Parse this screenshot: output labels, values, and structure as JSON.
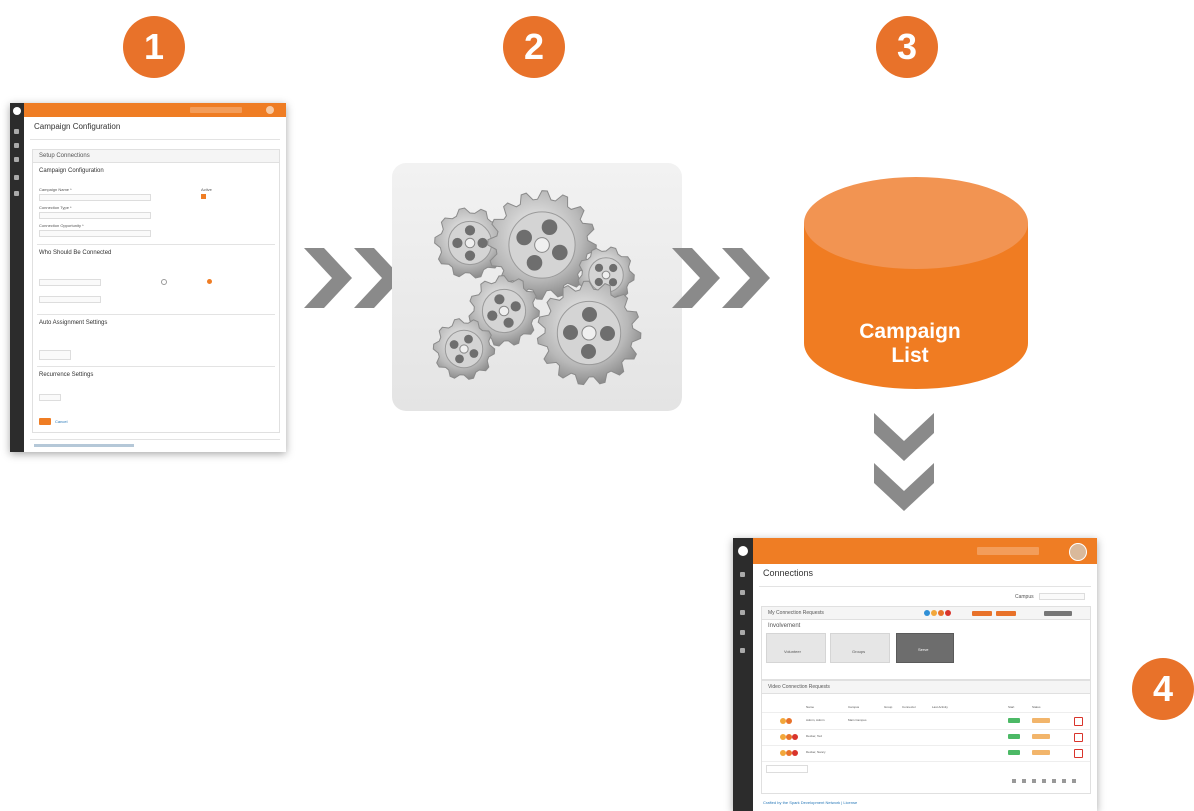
{
  "steps": [
    "1",
    "2",
    "3",
    "4"
  ],
  "colors": {
    "accent": "#e8722a",
    "cylinder": "#f07c22",
    "chevron": "#8a8a8a",
    "sidebar": "#2c2c2c"
  },
  "screenshot1": {
    "page_title": "Campaign Configuration",
    "panel_header": "Setup Connections",
    "section_title": "Campaign Configuration",
    "fields": [
      "Campaign Name *",
      "Connection Type *",
      "Connection Opportunity *"
    ],
    "active_label": "Active",
    "who_title": "Who Should Be Connected",
    "auto_title": "Auto Assignment Settings",
    "recurrence_title": "Recurrence Settings",
    "save_label": "Save",
    "cancel_label": "Cancel"
  },
  "cylinder_label": [
    "Campaign",
    "List"
  ],
  "screenshot4": {
    "page_title": "Connections",
    "campus_label": "Campus",
    "panel1_title": "My Connection Requests",
    "group_title": "Involvement",
    "cards": [
      "Volunteer",
      "Groups",
      "Serve"
    ],
    "panel2_title": "Video Connection Requests",
    "columns": [
      "Name",
      "Campus",
      "Group",
      "Connector",
      "Last Activity",
      "Start",
      "Status"
    ],
    "rows": [
      {
        "name": "Admin, Admin",
        "campus": "Main Campus"
      },
      {
        "name": "Decker, Ted"
      },
      {
        "name": "Decker, Nancy"
      }
    ],
    "footer": "Crafted by the Spark Development Network | License"
  }
}
